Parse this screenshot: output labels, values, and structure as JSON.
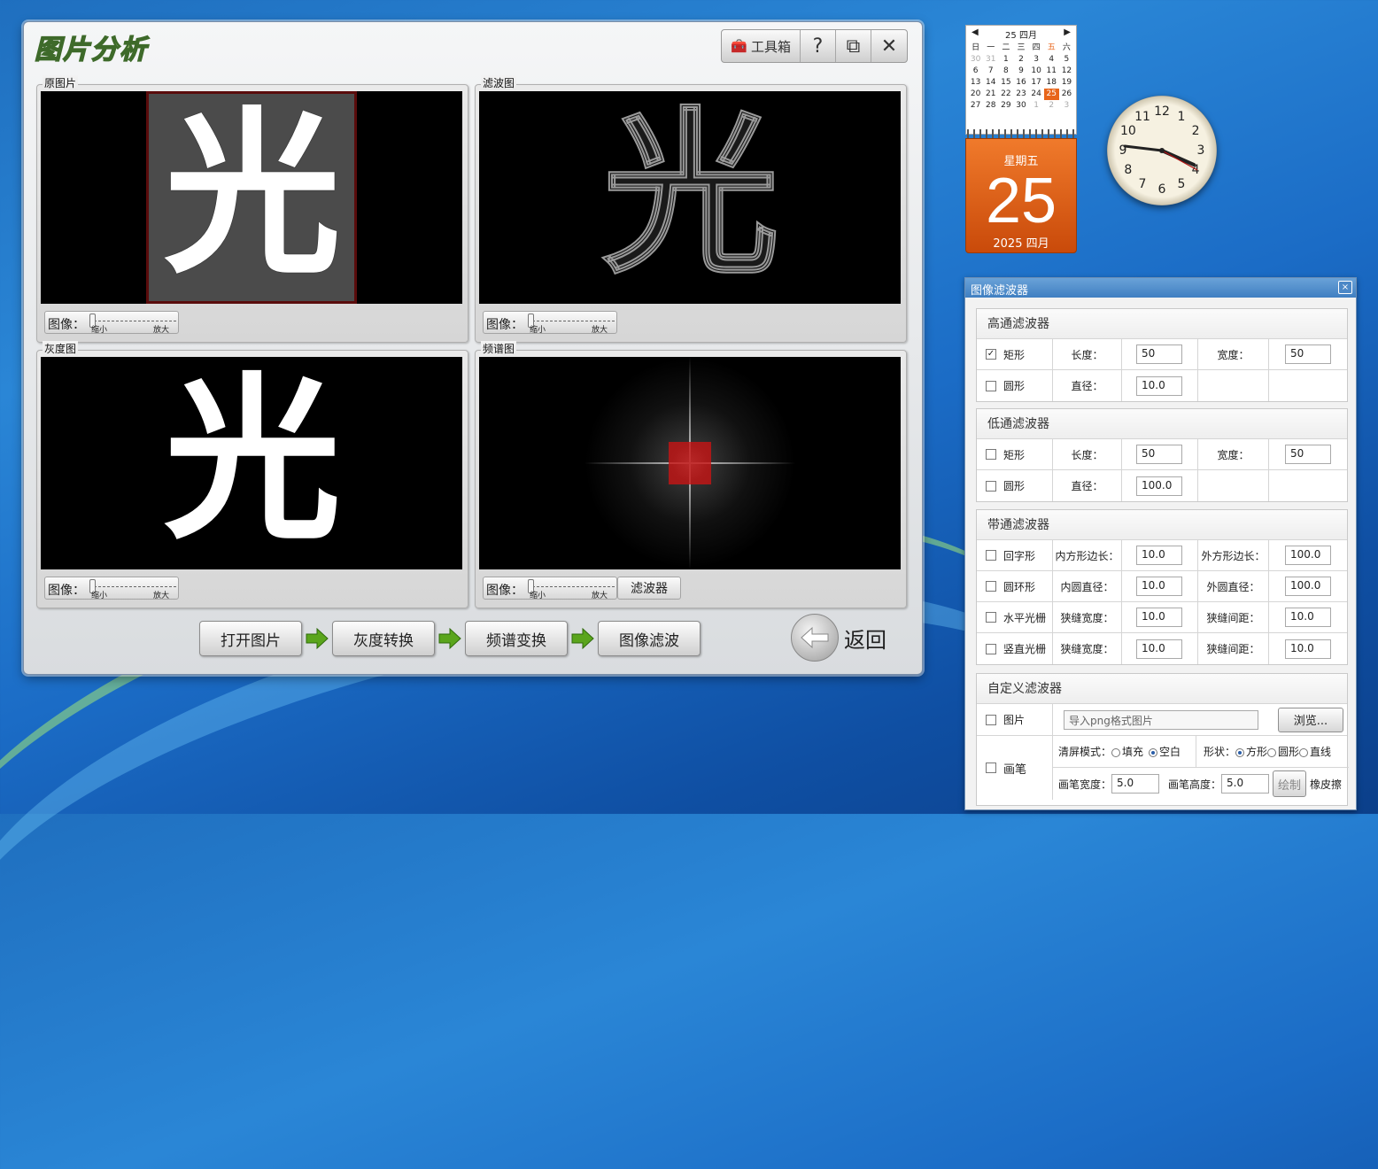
{
  "app": {
    "title": "图片分析",
    "toolbar": {
      "toolbox": "工具箱",
      "help": "?",
      "restore": "⧉",
      "close": "✕"
    },
    "panels": {
      "original": {
        "label": "原图片"
      },
      "filtered": {
        "label": "滤波图"
      },
      "gray": {
        "label": "灰度图"
      },
      "spectrum": {
        "label": "频谱图"
      }
    },
    "viewer_char": "光",
    "zoom": {
      "label": "图像：",
      "small": "缩小",
      "large": "放大"
    },
    "filter_button": "滤波器",
    "steps": [
      "打开图片",
      "灰度转换",
      "频谱变换",
      "图像滤波"
    ],
    "back": "返回"
  },
  "calendar": {
    "header": "25 四月",
    "weekdays": [
      "日",
      "一",
      "二",
      "三",
      "四",
      "五",
      "六"
    ],
    "rows": [
      [
        "30",
        "31",
        "1",
        "2",
        "3",
        "4",
        "5"
      ],
      [
        "6",
        "7",
        "8",
        "9",
        "10",
        "11",
        "12"
      ],
      [
        "13",
        "14",
        "15",
        "16",
        "17",
        "18",
        "19"
      ],
      [
        "20",
        "21",
        "22",
        "23",
        "24",
        "25",
        "26"
      ],
      [
        "27",
        "28",
        "29",
        "30",
        "1",
        "2",
        "3"
      ]
    ],
    "weekday_name": "星期五",
    "day": "25",
    "year_month": "2025 四月"
  },
  "clock": {
    "numbers": [
      "12",
      "1",
      "2",
      "3",
      "4",
      "5",
      "6",
      "7",
      "8",
      "9",
      "10",
      "11"
    ]
  },
  "dialog": {
    "title": "图像滤波器",
    "close": "×",
    "highpass": {
      "title": "高通滤波器",
      "rect": {
        "label": "矩形",
        "checked": true,
        "length_label": "长度：",
        "length": "50",
        "width_label": "宽度：",
        "width": "50"
      },
      "circle": {
        "label": "圆形",
        "diameter_label": "直径：",
        "diameter": "10.0"
      }
    },
    "lowpass": {
      "title": "低通滤波器",
      "rect": {
        "label": "矩形",
        "length_label": "长度：",
        "length": "50",
        "width_label": "宽度：",
        "width": "50"
      },
      "circle": {
        "label": "圆形",
        "diameter_label": "直径：",
        "diameter": "100.0"
      }
    },
    "bandpass": {
      "title": "带通滤波器",
      "rows": [
        {
          "label": "回字形",
          "a_label": "内方形边长：",
          "a": "10.0",
          "b_label": "外方形边长：",
          "b": "100.0"
        },
        {
          "label": "圆环形",
          "a_label": "内圆直径：",
          "a": "10.0",
          "b_label": "外圆直径：",
          "b": "100.0"
        },
        {
          "label": "水平光栅",
          "a_label": "狭缝宽度：",
          "a": "10.0",
          "b_label": "狭缝间距：",
          "b": "10.0"
        },
        {
          "label": "竖直光栅",
          "a_label": "狭缝宽度：",
          "a": "10.0",
          "b_label": "狭缝间距：",
          "b": "10.0"
        }
      ]
    },
    "custom": {
      "title": "自定义滤波器",
      "image_label": "图片",
      "image_placeholder": "导入png格式图片",
      "browse": "浏览...",
      "brush_label": "画笔",
      "clear_mode_label": "清屏模式：",
      "fill": "填充",
      "blank": "空白",
      "shape_label": "形状：",
      "square": "方形",
      "round": "圆形",
      "line": "直线",
      "brush_width_label": "画笔宽度：",
      "brush_width": "5.0",
      "brush_height_label": "画笔高度：",
      "brush_height": "5.0",
      "draw": "绘制",
      "eraser": "橡皮擦"
    }
  }
}
